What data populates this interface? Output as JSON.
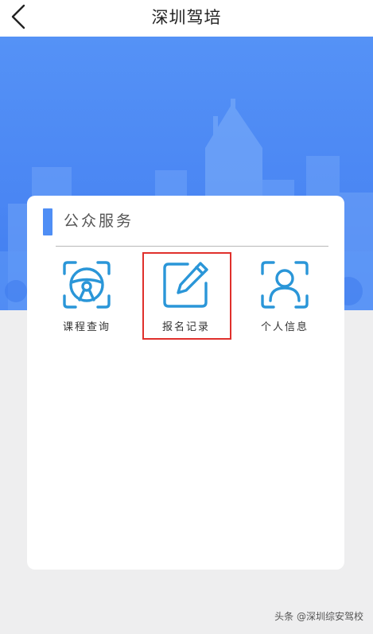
{
  "header": {
    "title": "深圳驾培",
    "back_icon": "chevron-left-icon"
  },
  "card": {
    "title": "公众服务",
    "services": [
      {
        "label": "课程查询",
        "icon": "steering-wheel-icon"
      },
      {
        "label": "报名记录",
        "icon": "edit-icon"
      },
      {
        "label": "个人信息",
        "icon": "person-icon"
      }
    ]
  },
  "highlight": {
    "target": "报名记录",
    "color": "#e0302c"
  },
  "watermark": "头条 @深圳综安驾校",
  "colors": {
    "accent": "#4f8ef5",
    "icon": "#2a96d8",
    "banner": "#4a86f3"
  }
}
